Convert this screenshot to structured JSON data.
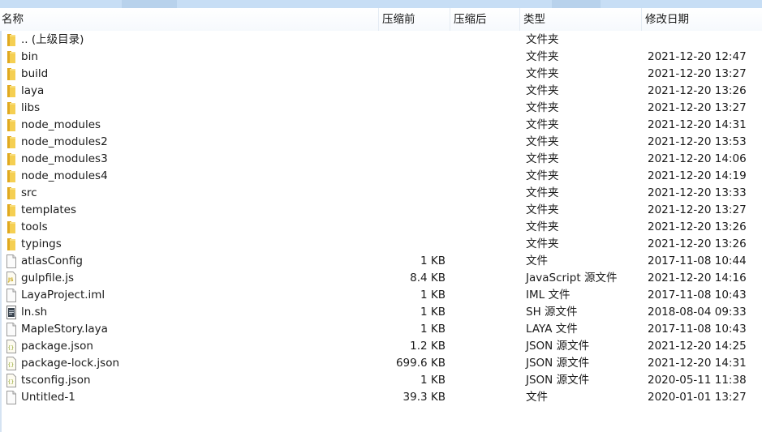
{
  "columns": {
    "name": "名称",
    "size": "压缩前",
    "packed": "压缩后",
    "type": "类型",
    "modified": "修改日期"
  },
  "colors": {
    "folder": "#e8b931",
    "header_bar": "#c7def5"
  },
  "files": [
    {
      "icon": "folder-icon",
      "name": ".. (上级目录)",
      "size": "",
      "type": "文件夹",
      "date": ""
    },
    {
      "icon": "folder-icon",
      "name": "bin",
      "size": "",
      "type": "文件夹",
      "date": "2021-12-20 12:47"
    },
    {
      "icon": "folder-icon",
      "name": "build",
      "size": "",
      "type": "文件夹",
      "date": "2021-12-20 13:27"
    },
    {
      "icon": "folder-icon",
      "name": "laya",
      "size": "",
      "type": "文件夹",
      "date": "2021-12-20 13:26"
    },
    {
      "icon": "folder-icon",
      "name": "libs",
      "size": "",
      "type": "文件夹",
      "date": "2021-12-20 13:27"
    },
    {
      "icon": "folder-icon",
      "name": "node_modules",
      "size": "",
      "type": "文件夹",
      "date": "2021-12-20 14:31"
    },
    {
      "icon": "folder-icon",
      "name": "node_modules2",
      "size": "",
      "type": "文件夹",
      "date": "2021-12-20 13:53"
    },
    {
      "icon": "folder-icon",
      "name": "node_modules3",
      "size": "",
      "type": "文件夹",
      "date": "2021-12-20 14:06"
    },
    {
      "icon": "folder-icon",
      "name": "node_modules4",
      "size": "",
      "type": "文件夹",
      "date": "2021-12-20 14:19"
    },
    {
      "icon": "folder-icon",
      "name": "src",
      "size": "",
      "type": "文件夹",
      "date": "2021-12-20 13:33"
    },
    {
      "icon": "folder-icon",
      "name": "templates",
      "size": "",
      "type": "文件夹",
      "date": "2021-12-20 13:27"
    },
    {
      "icon": "folder-icon",
      "name": "tools",
      "size": "",
      "type": "文件夹",
      "date": "2021-12-20 13:26"
    },
    {
      "icon": "folder-icon",
      "name": "typings",
      "size": "",
      "type": "文件夹",
      "date": "2021-12-20 13:26"
    },
    {
      "icon": "file-icon",
      "name": "atlasConfig",
      "size": "1 KB",
      "type": "文件",
      "date": "2017-11-08 10:44"
    },
    {
      "icon": "js-file-icon",
      "name": "gulpfile.js",
      "size": "8.4 KB",
      "type": "JavaScript 源文件",
      "date": "2021-12-20 14:16"
    },
    {
      "icon": "file-icon",
      "name": "LayaProject.iml",
      "size": "1 KB",
      "type": "IML 文件",
      "date": "2017-11-08 10:43"
    },
    {
      "icon": "shell-script-icon",
      "name": "ln.sh",
      "size": "1 KB",
      "type": "SH 源文件",
      "date": "2018-08-04 09:33"
    },
    {
      "icon": "file-icon",
      "name": "MapleStory.laya",
      "size": "1 KB",
      "type": "LAYA 文件",
      "date": "2017-11-08 10:43"
    },
    {
      "icon": "json-file-icon",
      "name": "package.json",
      "size": "1.2 KB",
      "type": "JSON 源文件",
      "date": "2021-12-20 14:25"
    },
    {
      "icon": "json-file-icon",
      "name": "package-lock.json",
      "size": "699.6 KB",
      "type": "JSON 源文件",
      "date": "2021-12-20 14:31"
    },
    {
      "icon": "json-file-icon",
      "name": "tsconfig.json",
      "size": "1 KB",
      "type": "JSON 源文件",
      "date": "2020-05-11 11:38"
    },
    {
      "icon": "file-icon",
      "name": "Untitled-1",
      "size": "39.3 KB",
      "type": "文件",
      "date": "2020-01-01 13:27"
    }
  ]
}
